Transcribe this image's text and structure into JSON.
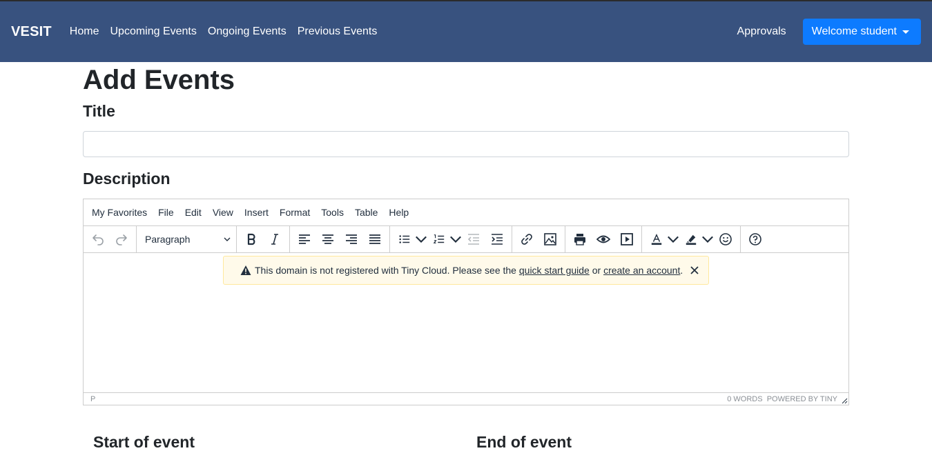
{
  "navbar": {
    "brand": "VESIT",
    "links": [
      "Home",
      "Upcoming Events",
      "Ongoing Events",
      "Previous Events"
    ],
    "approvals": "Approvals",
    "user_menu": "Welcome student",
    "bg_color": "#38527f",
    "button_color": "#0d7bff"
  },
  "page": {
    "title": "Add Events",
    "title_label": "Title",
    "title_value": "",
    "description_label": "Description",
    "start_label": "Start of event",
    "end_label": "End of event"
  },
  "editor": {
    "menu": [
      "My Favorites",
      "File",
      "Edit",
      "View",
      "Insert",
      "Format",
      "Tools",
      "Table",
      "Help"
    ],
    "block_format": "Paragraph",
    "toolbar_icons": [
      "undo-icon",
      "redo-icon",
      "bold-icon",
      "italic-icon",
      "align-left-icon",
      "align-center-icon",
      "align-right-icon",
      "align-justify-icon",
      "bullet-list-icon",
      "numbered-list-icon",
      "outdent-icon",
      "indent-icon",
      "link-icon",
      "image-icon",
      "print-icon",
      "preview-icon",
      "media-icon",
      "text-color-icon",
      "highlight-icon",
      "emoticons-icon",
      "help-icon"
    ],
    "notice": {
      "text_before": "This domain is not registered with Tiny Cloud. Please see the",
      "link1": "quick start guide",
      "text_middle": "or",
      "link2": "create an account",
      "text_after": "."
    },
    "status": {
      "path": "P",
      "words": "0 WORDS",
      "powered": "POWERED BY TINY"
    }
  }
}
